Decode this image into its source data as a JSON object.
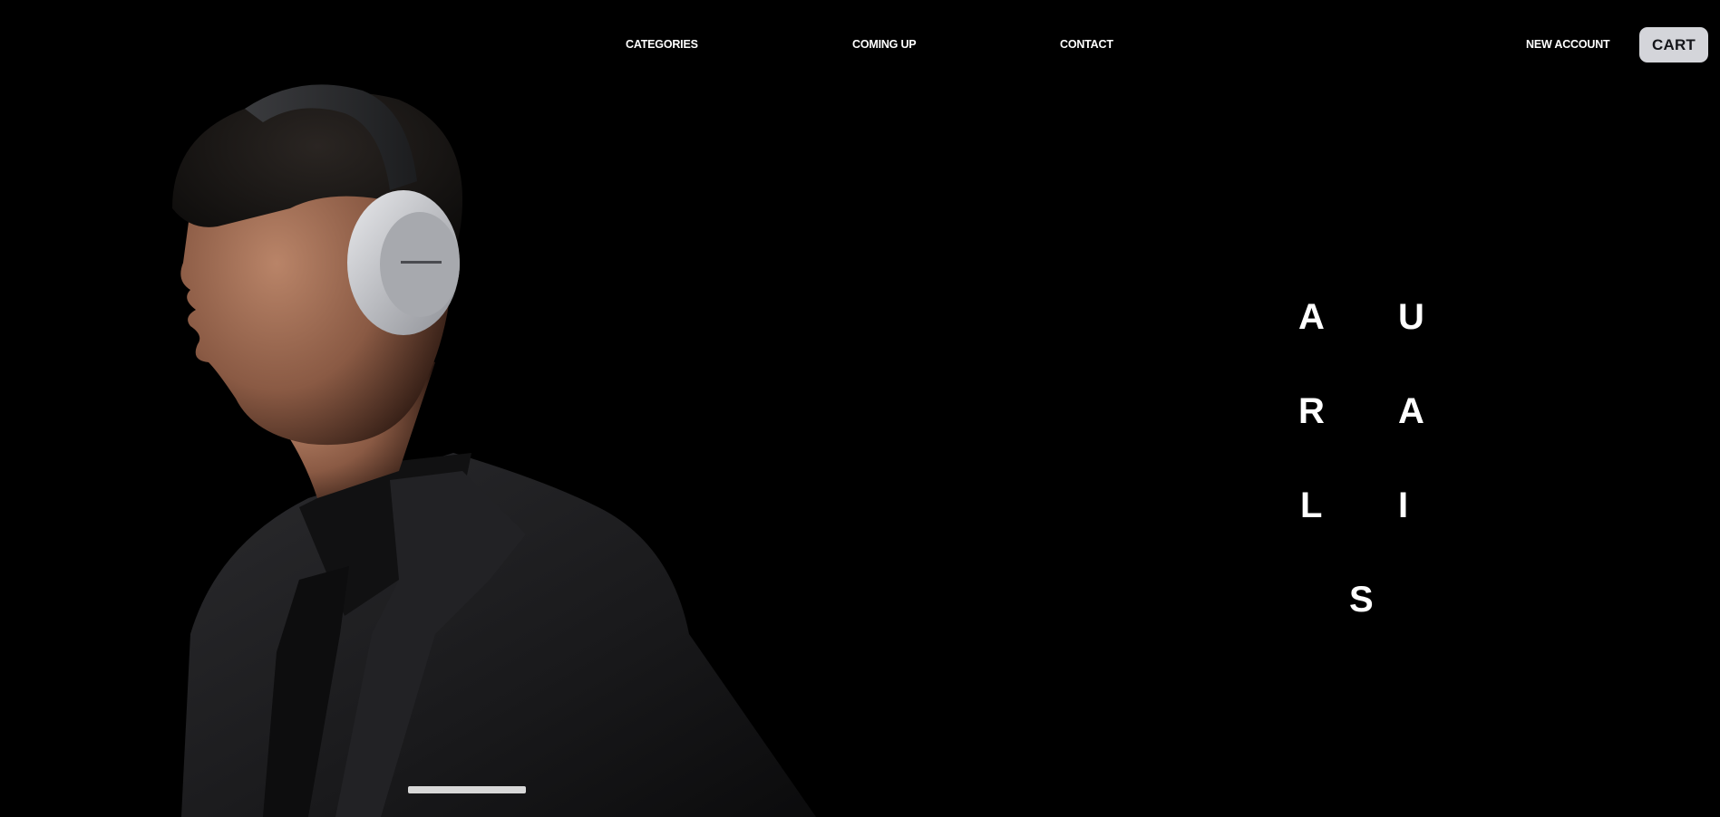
{
  "nav": {
    "links": [
      {
        "label": "CATEGORIES"
      },
      {
        "label": "COMING UP"
      },
      {
        "label": "CONTACT"
      }
    ],
    "account_label": "NEW ACCOUNT",
    "cart_label": "CART"
  },
  "brand": {
    "letters": [
      "A",
      "U",
      "R",
      "A",
      "L",
      "I",
      "S"
    ]
  },
  "hero": {
    "image": "man-with-headphones-photo"
  },
  "colors": {
    "background": "#000000",
    "text": "#ffffff",
    "cart_button_bg": "#d4d5da",
    "cart_button_text": "#14151a"
  }
}
